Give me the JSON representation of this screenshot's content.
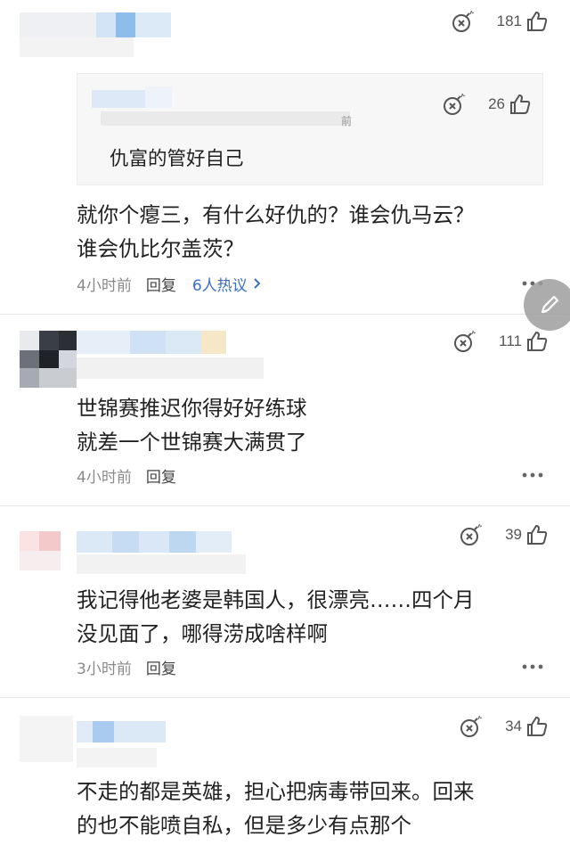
{
  "comments": [
    {
      "likes": "181",
      "quoted": {
        "likes": "26",
        "text": "仇富的管好自己",
        "name_fragment": "前"
      },
      "text_lines": [
        "就你个瘪三，有什么好仇的？谁会仇马云？",
        "谁会仇比尔盖茨？"
      ],
      "time": "4小时前",
      "reply_label": "回复",
      "hot_label": "6人热议",
      "bomb_icon": "bomb-icon",
      "like_icon": "thumbs-up-icon"
    },
    {
      "likes": "111",
      "text_lines": [
        "世锦赛推迟你得好好练球",
        "就差一个世锦赛大满贯了"
      ],
      "time": "4小时前",
      "reply_label": "回复"
    },
    {
      "likes": "39",
      "text_lines": [
        "我记得他老婆是韩国人，很漂亮……四个月",
        "没见面了，哪得涝成啥样啊"
      ],
      "time": "3小时前",
      "reply_label": "回复"
    },
    {
      "likes": "34",
      "text_lines": [
        "不走的都是英雄，担心把病毒带回来。回来",
        "的也不能喷自私，但是多少有点那个"
      ]
    }
  ],
  "fab_icon": "pencil-icon",
  "colors": {
    "link": "#3d6fbf",
    "meta": "#8a8a8a",
    "divider": "#e6e6e6"
  }
}
